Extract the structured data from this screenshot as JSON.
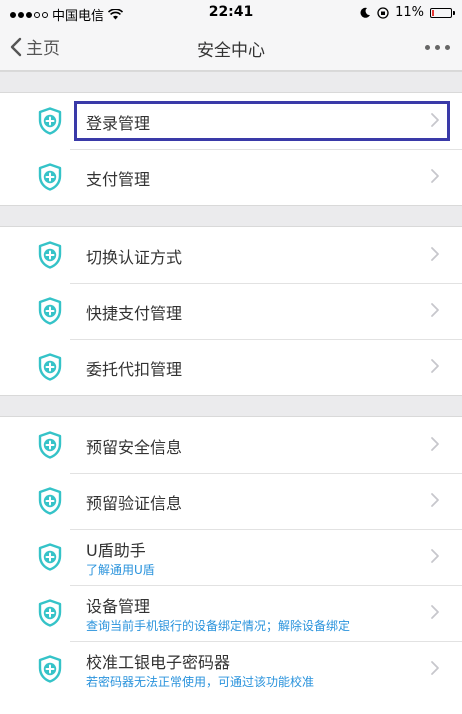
{
  "status_bar": {
    "carrier": "中国电信",
    "time": "22:41",
    "battery_percent": "11%",
    "battery_level": 0.11,
    "icons": [
      "signal-dots-icon",
      "wifi-icon",
      "moon-icon",
      "orientation-lock-icon",
      "battery-icon"
    ]
  },
  "nav": {
    "back_label": "主页",
    "title": "安全中心",
    "more_icon": "more-dots-icon"
  },
  "colors": {
    "accent": "#35c3c8",
    "highlight_border": "#3a3aa8",
    "subtitle": "#2a93dc",
    "battery_low": "#e53935"
  },
  "sections": [
    {
      "items": [
        {
          "label": "登录管理",
          "highlighted": true
        },
        {
          "label": "支付管理"
        }
      ]
    },
    {
      "items": [
        {
          "label": "切换认证方式"
        },
        {
          "label": "快捷支付管理"
        },
        {
          "label": "委托代扣管理"
        }
      ]
    },
    {
      "items": [
        {
          "label": "预留安全信息"
        },
        {
          "label": "预留验证信息"
        },
        {
          "label": "U盾助手",
          "subtitle": "了解通用U盾"
        },
        {
          "label": "设备管理",
          "subtitle": "查询当前手机银行的设备绑定情况；解除设备绑定"
        },
        {
          "label": "校准工银电子密码器",
          "subtitle": "若密码器无法正常使用，可通过该功能校准"
        }
      ]
    }
  ]
}
